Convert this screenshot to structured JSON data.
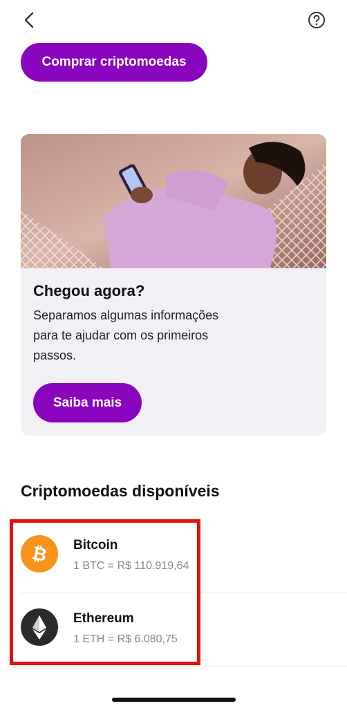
{
  "header": {
    "back_icon": "chevron-left-icon",
    "help_icon": "question-circle-icon"
  },
  "buy_button": {
    "label": "Comprar criptomoedas"
  },
  "info_card": {
    "title": "Chegou agora?",
    "text": "Separamos algumas informações para te ajudar com os primeiros passos.",
    "button_label": "Saiba mais"
  },
  "coins_section": {
    "title": "Criptomoedas disponíveis",
    "items": [
      {
        "name": "Bitcoin",
        "rate": "1 BTC = R$ 110.919,64",
        "icon": "bitcoin-icon",
        "color": "#f7931a"
      },
      {
        "name": "Ethereum",
        "rate": "1 ETH = R$ 6.080,75",
        "icon": "ethereum-icon",
        "color": "#2b2b2b"
      }
    ]
  },
  "colors": {
    "accent": "#8a05be",
    "highlight": "#e3120b"
  }
}
